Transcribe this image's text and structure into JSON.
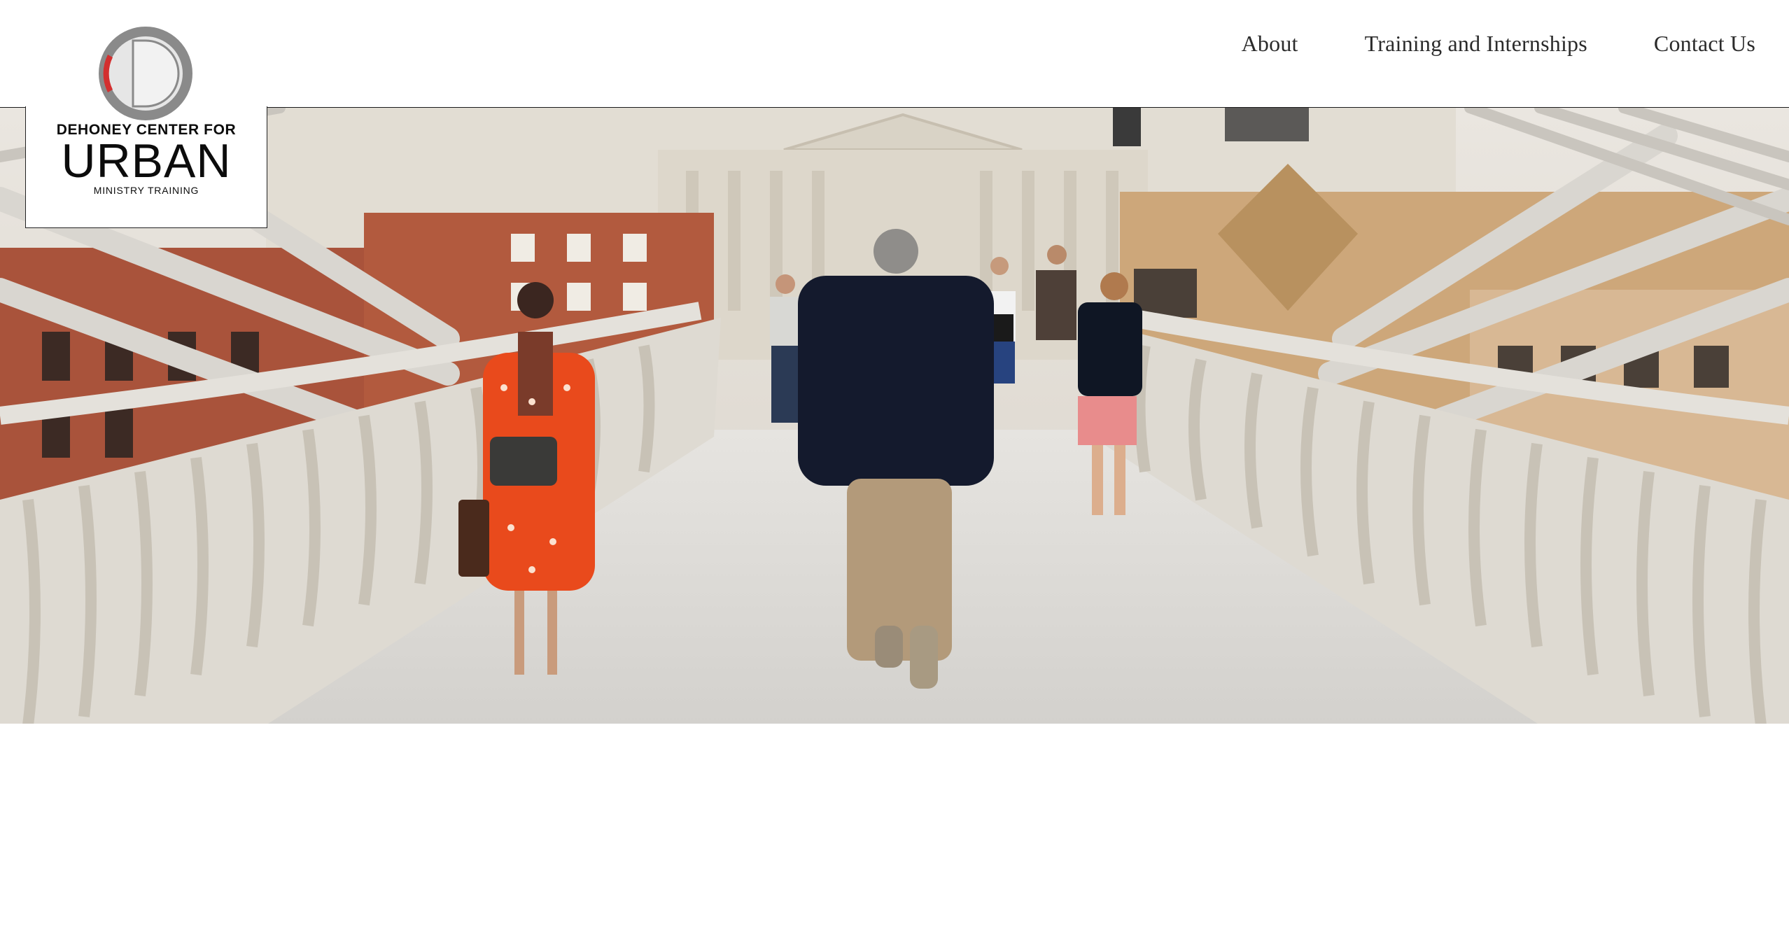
{
  "logo": {
    "line1": "DEHONEY CENTER FOR",
    "line2": "URBAN",
    "line3": "MINISTRY TRAINING",
    "ring_color": "#8a8a8a",
    "accent_color": "#d32f2f"
  },
  "nav": {
    "items": [
      {
        "label": "About"
      },
      {
        "label": "Training and Internships"
      },
      {
        "label": "Contact Us"
      }
    ]
  },
  "hero": {
    "image": "photo-people-walking-on-footbridge"
  }
}
